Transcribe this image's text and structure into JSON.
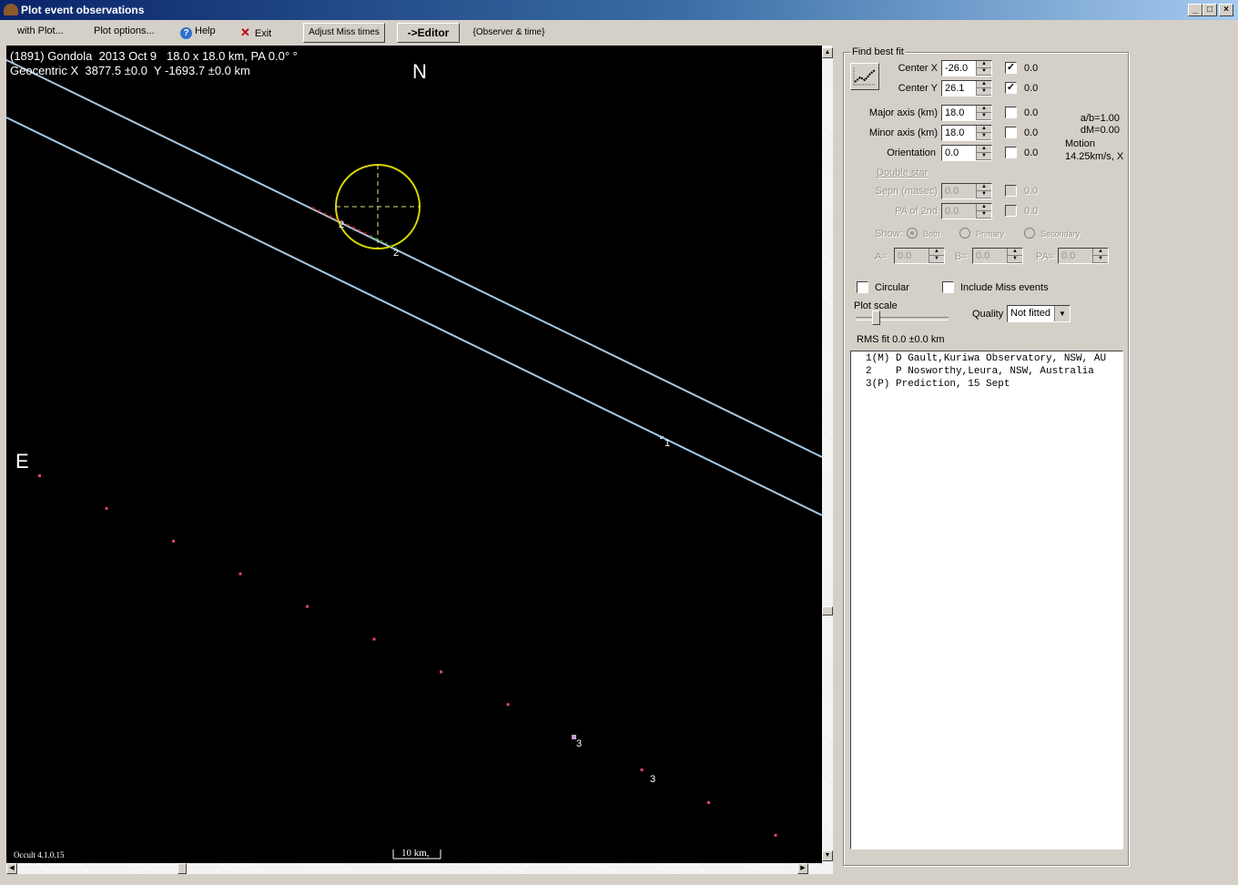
{
  "window": {
    "title": "Plot event observations",
    "controls": {
      "minimize": "_",
      "maximize": "□",
      "close": "×"
    }
  },
  "menu": {
    "with_plot": "with Plot...",
    "plot_options": "Plot options...",
    "help": "Help",
    "exit": "Exit",
    "adjust_miss_times": "Adjust Miss times",
    "editor": "->Editor",
    "observer_time": "{Observer & time}"
  },
  "plot": {
    "header_line1": "(1891) Gondola  2013 Oct 9   18.0 x 18.0 km, PA 0.0° °",
    "header_line2": "Geocentric X  3877.5 ±0.0  Y -1693.7 ±0.0 km",
    "north_label": "N",
    "east_label": "E",
    "version": "Occult 4.1.0.15",
    "scale_label": "10 km,",
    "chord_labels": [
      "1",
      "2",
      "2",
      "3",
      "3"
    ],
    "colors": {
      "background": "#000000",
      "chord": "#a8c8e0",
      "ellipse": "#d8d800",
      "prediction": "#e0407a",
      "miss_segment": "#d02020",
      "fit_segment": "#1e8a1e"
    }
  },
  "fit_panel": {
    "group_title": "Find best fit",
    "center_x": {
      "label": "Center X",
      "value": "-26.0",
      "checked": true,
      "uncertainty": "0.0"
    },
    "center_y": {
      "label": "Center Y",
      "value": "26.1",
      "checked": true,
      "uncertainty": "0.0"
    },
    "major_axis": {
      "label": "Major axis (km)",
      "value": "18.0",
      "checked": false,
      "uncertainty": "0.0"
    },
    "minor_axis": {
      "label": "Minor axis (km)",
      "value": "18.0",
      "checked": false,
      "uncertainty": "0.0"
    },
    "orientation": {
      "label": "Orientation",
      "value": "0.0",
      "checked": false,
      "uncertainty": "0.0"
    },
    "ab_ratio": "a/b=1.00",
    "dm": "dM=0.00",
    "motion_label": "Motion",
    "motion_value": "14.25km/s, X",
    "double_star": {
      "title": "Double star",
      "sepn": {
        "label": "Sepn (masec)",
        "value": "0.0",
        "uncertainty": "0.0"
      },
      "pa2": {
        "label": "PA of 2nd",
        "value": "0.0",
        "uncertainty": "0.0"
      },
      "show_label": "Show:",
      "show_options": [
        "Both",
        "Primary",
        "Secondary"
      ],
      "show_selected": "Both",
      "a_label": "A=",
      "a_value": "0.0",
      "b_label": "B=",
      "b_value": "0.0",
      "pa_label": "PA=",
      "pa_value": "0.0"
    },
    "circular": {
      "label": "Circular",
      "checked": false
    },
    "include_miss": {
      "label": "Include Miss events",
      "checked": false
    },
    "plot_scale_label": "Plot scale",
    "quality_label": "Quality",
    "quality_value": "Not fitted",
    "rms_fit": "RMS fit 0.0 ±0.0 km",
    "observers": [
      "1(M) D Gault,Kuriwa Observatory, NSW, AU",
      "2    P Nosworthy,Leura, NSW, Australia",
      "3(P) Prediction, 15 Sept"
    ]
  }
}
